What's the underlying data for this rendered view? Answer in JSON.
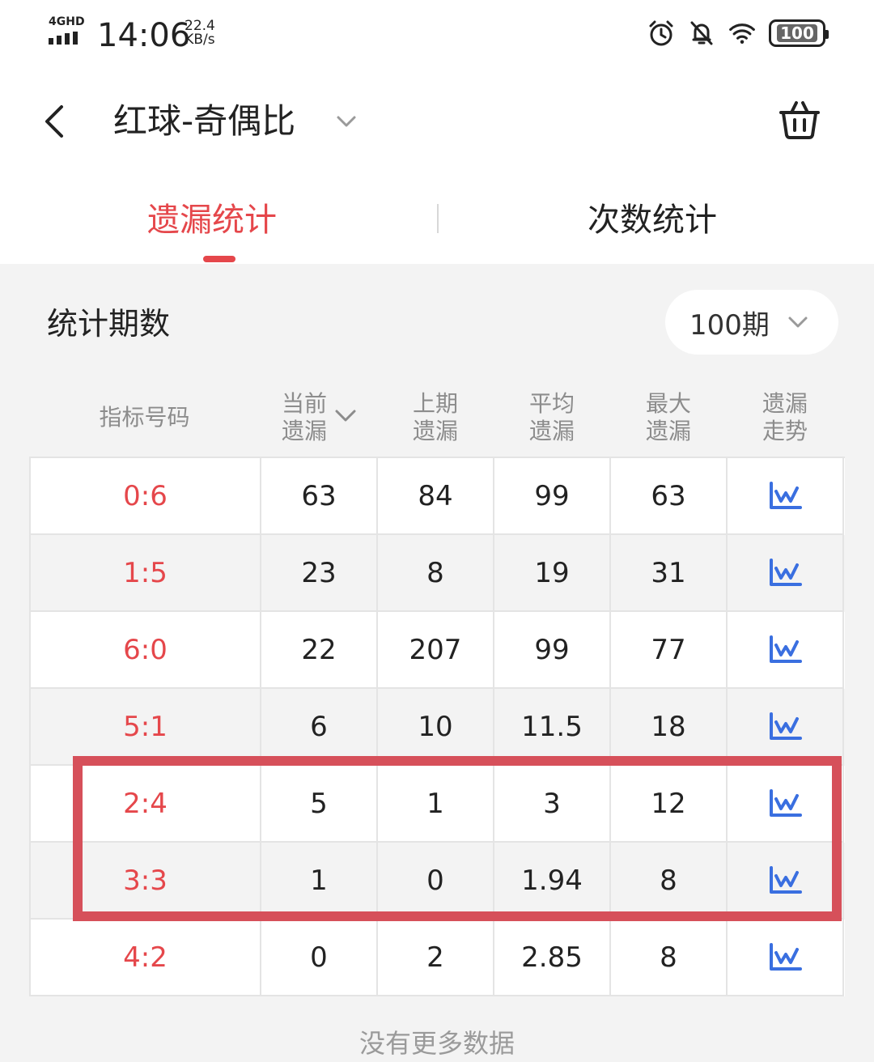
{
  "status_bar": {
    "network": "4GHD",
    "time": "14:06",
    "speed_value": "22.4",
    "speed_unit": "KB/s",
    "battery": "100",
    "icons": [
      "alarm-icon",
      "mute-bell-icon",
      "wifi-icon",
      "battery-icon"
    ]
  },
  "header": {
    "title": "红球-奇偶比"
  },
  "tabs": [
    {
      "label": "遗漏统计",
      "active": true
    },
    {
      "label": "次数统计",
      "active": false
    }
  ],
  "period": {
    "label": "统计期数",
    "selected": "100期"
  },
  "table": {
    "headers": [
      {
        "line1": "指标号码",
        "line2": ""
      },
      {
        "line1": "当前",
        "line2": "遗漏"
      },
      {
        "line1": "上期",
        "line2": "遗漏"
      },
      {
        "line1": "平均",
        "line2": "遗漏"
      },
      {
        "line1": "最大",
        "line2": "遗漏"
      },
      {
        "line1": "遗漏",
        "line2": "走势"
      }
    ],
    "rows": [
      {
        "code": "0:6",
        "current": "63",
        "previous": "84",
        "average": "99",
        "max": "63"
      },
      {
        "code": "1:5",
        "current": "23",
        "previous": "8",
        "average": "19",
        "max": "31"
      },
      {
        "code": "6:0",
        "current": "22",
        "previous": "207",
        "average": "99",
        "max": "77"
      },
      {
        "code": "5:1",
        "current": "6",
        "previous": "10",
        "average": "11.5",
        "max": "18"
      },
      {
        "code": "2:4",
        "current": "5",
        "previous": "1",
        "average": "3",
        "max": "12"
      },
      {
        "code": "3:3",
        "current": "1",
        "previous": "0",
        "average": "1.94",
        "max": "8"
      },
      {
        "code": "4:2",
        "current": "0",
        "previous": "2",
        "average": "2.85",
        "max": "8"
      }
    ]
  },
  "footer": "没有更多数据",
  "colors": {
    "accent": "#e5474b",
    "highlight_border": "#d6505a",
    "trend_icon": "#3a6fe0"
  }
}
